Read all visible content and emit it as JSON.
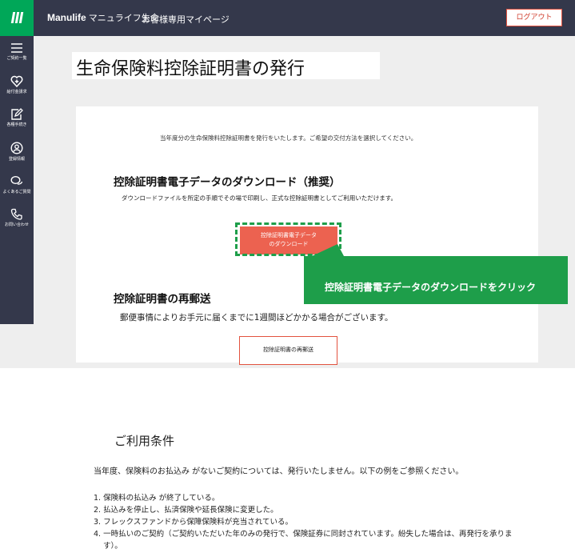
{
  "header": {
    "brand_name": "Manulife",
    "brand_jp": "マニュライフ生命",
    "site_title": "お客様専用マイページ",
    "logout_label": "ログアウト"
  },
  "sidebar": {
    "items": [
      {
        "label": "ご契約一覧",
        "icon": "list-icon"
      },
      {
        "label": "給付金請求",
        "icon": "heart-plus-icon"
      },
      {
        "label": "各種手続き",
        "icon": "edit-icon"
      },
      {
        "label": "登録情報",
        "icon": "person-icon"
      },
      {
        "label": "よくあるご質問",
        "icon": "chat-icon"
      },
      {
        "label": "お問い合わせ",
        "icon": "phone-icon"
      }
    ]
  },
  "main": {
    "page_title": "生命保険料控除証明書の発行",
    "intro": "当年度分の生命保険料控除証明書を発行をいたします。ご希望の交付方法を選択してください。",
    "download_section": {
      "title": "控除証明書電子データのダウンロード（推奨）",
      "description": "ダウンロードファイルを所定の手順でその場で印刷し、正式な控除証明書としてご利用いただけます。",
      "button_line1": "控除証明書電子データ",
      "button_line2": "のダウンロード"
    },
    "callout": "控除証明書電子データのダウンロードをクリック",
    "remail_section": {
      "title": "控除証明書の再郵送",
      "description": "郵便事情によりお手元に届くまでに1週間ほどかかる場合がございます。",
      "button_label": "控除証明書の再郵送"
    }
  },
  "terms": {
    "title": "ご利用条件",
    "intro": "当年度、保険料のお払込み がないご契約については、発行いたしません。以下の例をご参照ください。",
    "items": [
      "1. 保険料の払込み が終了している。",
      "2. 払込みを停止し、払済保険や延長保険に変更した。",
      "3. フレックスファンドから保障保険料が充当されている。",
      "4. 一時払いのご契約（ご契約いただいた年のみの発行で、保険証券に同封されています。紛失した場合は、再発行を承りま",
      "す）。"
    ]
  },
  "colors": {
    "brand_green": "#00a758",
    "nav_dark": "#34384b",
    "accent_red": "#ec6250",
    "callout_green": "#1e9e4a"
  }
}
